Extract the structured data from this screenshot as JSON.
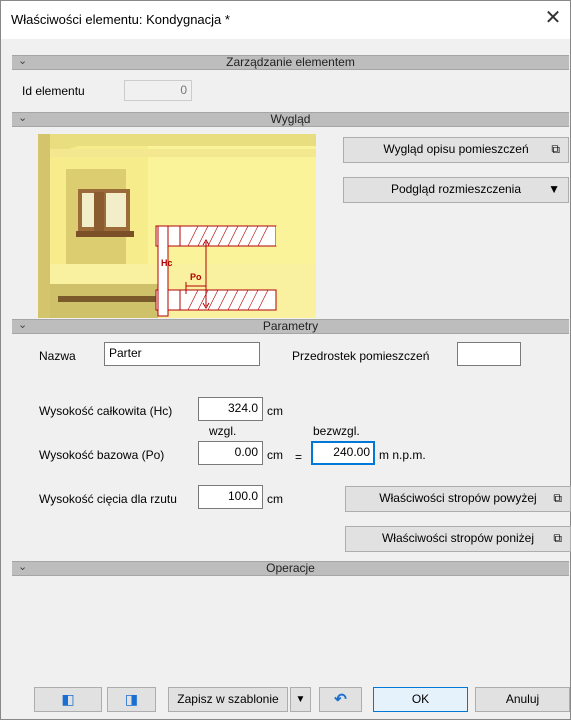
{
  "window": {
    "title": "Właściwości elementu: Kondygnacja *"
  },
  "sections": {
    "management": "Zarządzanie elementem",
    "appearance": "Wygląd",
    "parameters": "Parametry",
    "operations": "Operacje"
  },
  "management": {
    "id_label": "Id elementu",
    "id_value": "0"
  },
  "appearance": {
    "room_desc_button": "Wygląd opisu pomieszczeń",
    "layout_preview_button": "Podgląd rozmieszczenia",
    "illustration_labels": {
      "hc": "Hc",
      "po": "Po"
    }
  },
  "parameters": {
    "name_label": "Nazwa",
    "name_value": "Parter",
    "prefix_label": "Przedrostek pomieszczeń",
    "prefix_value": "",
    "total_height_label": "Wysokość całkowita (Hc)",
    "total_height_value": "324.0",
    "unit_cm": "cm",
    "relative_label": "wzgl.",
    "absolute_label": "bezwzgl.",
    "base_height_label": "Wysokość bazowa (Po)",
    "base_height_value": "0.00",
    "equals": "=",
    "absolute_value": "240.00",
    "unit_mnpm": "m n.p.m.",
    "cut_height_label": "Wysokość cięcia dla rzutu",
    "cut_height_value": "100.0",
    "slabs_above_button": "Właściwości stropów powyżej",
    "slabs_below_button": "Właściwości stropów poniżej"
  },
  "footer": {
    "save_template": "Zapisz w szablonie",
    "ok": "OK",
    "cancel": "Anuluj"
  },
  "colors": {
    "section_header": "#bdbdbd",
    "accent": "#0078d7",
    "illustration_bg": "#fdf5a6"
  }
}
